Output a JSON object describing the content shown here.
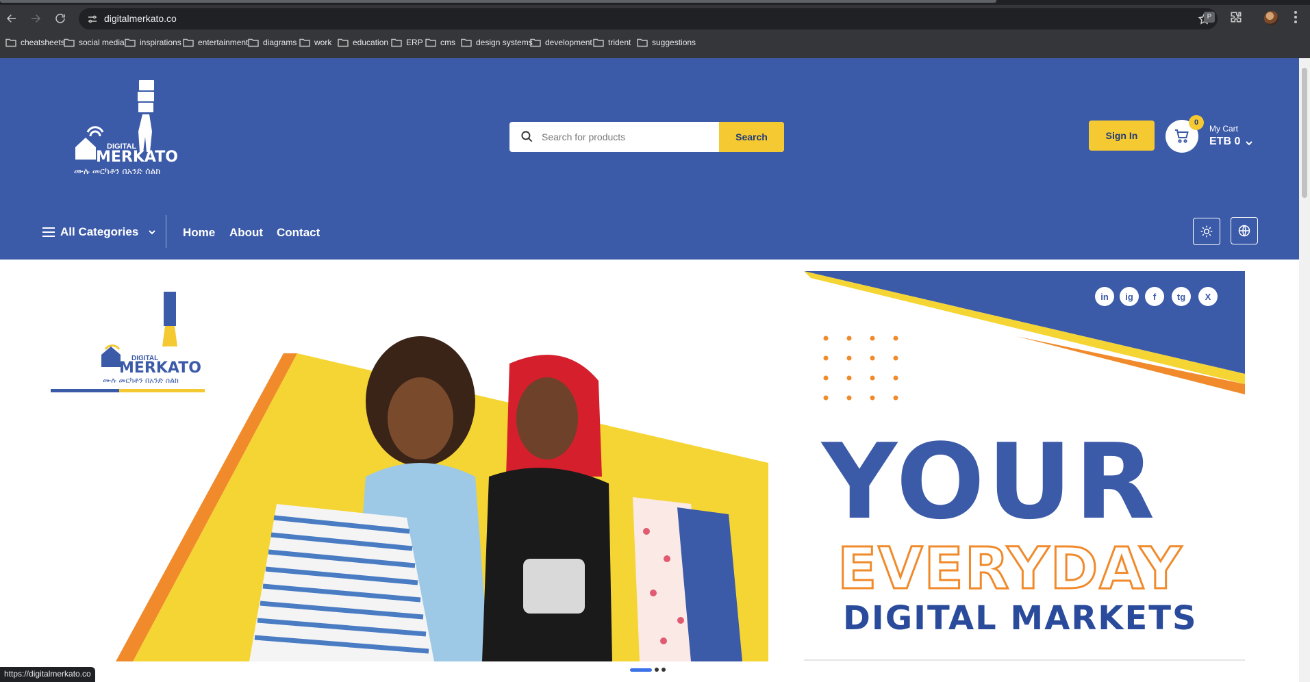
{
  "browser": {
    "url": "digitalmerkato.co",
    "status_url": "https://digitalmerkato.co",
    "profile_ext_letter": "P",
    "bookmarks": [
      "cheatsheets",
      "social media",
      "inspirations",
      "entertainment",
      "diagrams",
      "work",
      "education",
      "ERP",
      "cms",
      "design systems",
      "development",
      "trident",
      "suggestions"
    ]
  },
  "header": {
    "logo": {
      "brand_top": "DIGITAL",
      "brand_main": "MERKATO",
      "tagline": "ሙሉ መርካቶን በአንድ ሰልክ"
    },
    "search": {
      "placeholder": "Search for products",
      "button_label": "Search"
    },
    "sign_in_label": "Sign In",
    "cart": {
      "count": "0",
      "label": "My Cart",
      "total": "ETB 0"
    },
    "nav": {
      "categories_label": "All Categories",
      "links": [
        "Home",
        "About",
        "Contact"
      ]
    }
  },
  "hero": {
    "line1": "YOUR",
    "line2": "EVERYDAY",
    "line3": "DIGITAL  MARKETS",
    "socials": [
      "in",
      "ig",
      "f",
      "tg",
      "X"
    ],
    "carousel_slides": 3,
    "active_slide": 1
  },
  "colors": {
    "brand_blue": "#3b5aa8",
    "accent_yellow": "#f5c932",
    "accent_orange": "#f08a2b"
  }
}
